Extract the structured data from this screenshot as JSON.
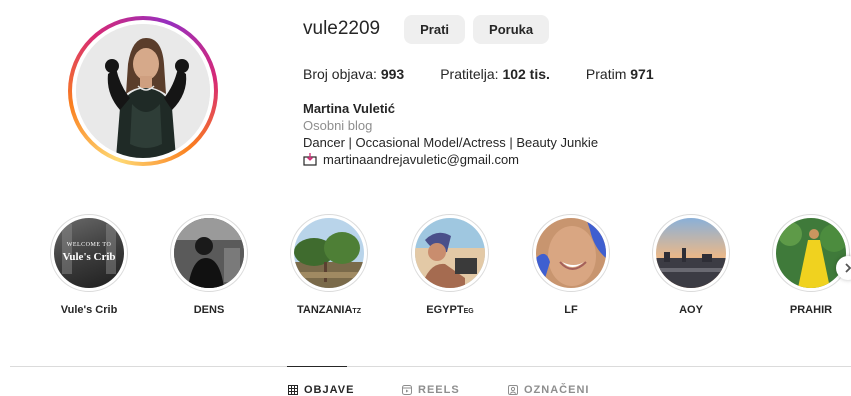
{
  "profile": {
    "username": "vule2209",
    "follow_label": "Prati",
    "message_label": "Poruka",
    "stats": {
      "posts_label": "Broj objava:",
      "posts_value": "993",
      "followers_label": "Pratitelja:",
      "followers_value": "102 tis.",
      "following_label": "Pratim",
      "following_value": "971"
    },
    "bio": {
      "name": "Martina Vuletić",
      "category": "Osobni blog",
      "text": "Dancer | Occasional Model/Actress | Beauty Junkie",
      "email": "martinaandrejavuletic@gmail.com"
    }
  },
  "highlights": [
    {
      "label": "Vule's Crib",
      "label_sub": "",
      "cover_title_small": "WELCOME TO",
      "cover_title": "Vule's Crib",
      "icon": "crib-cover"
    },
    {
      "label": "DENS",
      "label_sub": "",
      "icon": "dens-cover"
    },
    {
      "label": "TANZANIA",
      "label_sub": "TZ",
      "icon": "palm-trees-cover"
    },
    {
      "label": "EGYPT",
      "label_sub": "EG",
      "icon": "beach-cover"
    },
    {
      "label": "LF",
      "label_sub": "",
      "icon": "face-cover"
    },
    {
      "label": "AOY",
      "label_sub": "",
      "icon": "sunset-city-cover"
    },
    {
      "label": "PRAHIR",
      "label_sub": "",
      "icon": "yellow-dress-cover"
    }
  ],
  "tabs": [
    {
      "label": "OBJAVE",
      "icon": "grid-icon",
      "active": true
    },
    {
      "label": "REELS",
      "icon": "reels-icon",
      "active": false
    },
    {
      "label": "OZNAČENI",
      "icon": "tagged-icon",
      "active": false
    }
  ],
  "colors": {
    "ring_gradient": [
      "#feda75",
      "#fa7e1e",
      "#d62976",
      "#962fbf"
    ],
    "button_bg": "#efefef",
    "text_primary": "#262626",
    "text_secondary": "#8e8e8e",
    "divider": "#dbdbdb"
  }
}
